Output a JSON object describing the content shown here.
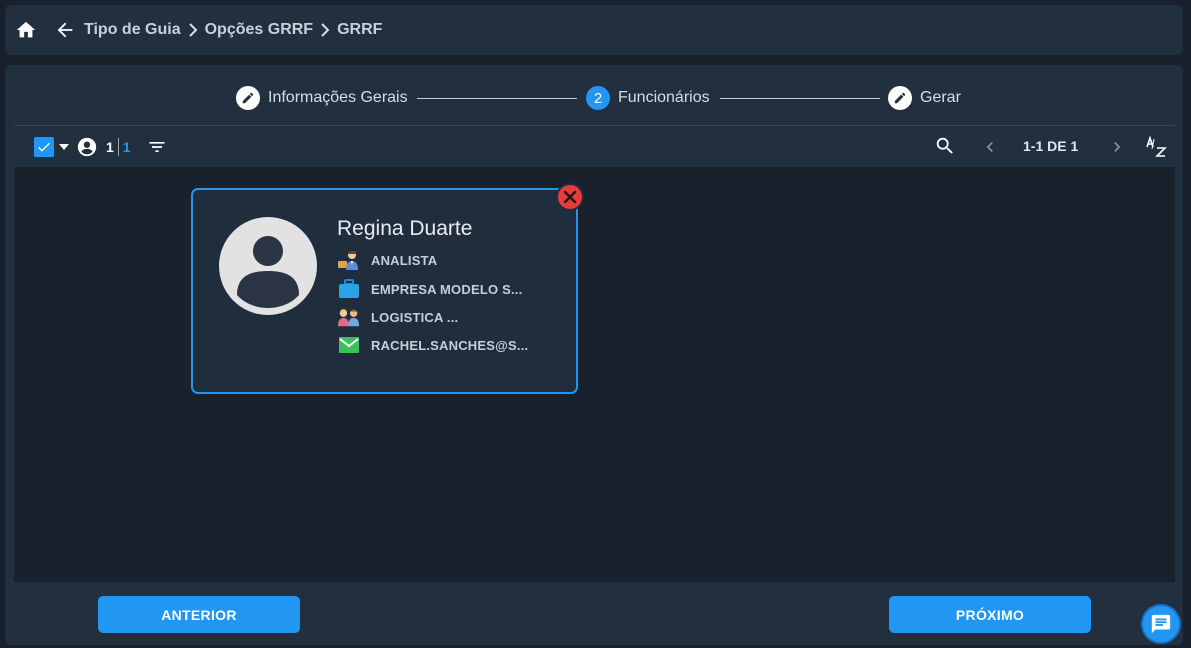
{
  "breadcrumb": {
    "items": [
      "Tipo de Guia",
      "Opções GRRF",
      "GRRF"
    ]
  },
  "stepper": {
    "steps": [
      {
        "label": "Informações Gerais",
        "icon": "pencil-icon"
      },
      {
        "label": "Funcionários",
        "number": "2"
      },
      {
        "label": "Gerar",
        "icon": "pencil-icon"
      }
    ]
  },
  "toolbar": {
    "selected_count": "1",
    "total_count": "1",
    "pagination": "1-1 DE 1"
  },
  "employee_card": {
    "name": "Regina Duarte",
    "role": "ANALISTA",
    "company": "EMPRESA MODELO S...",
    "department": "LOGISTICA ...",
    "email": "RACHEL.SANCHES@S..."
  },
  "footer": {
    "prev_label": "ANTERIOR",
    "next_label": "PRÓXIMO"
  },
  "colors": {
    "accent": "#2196f3",
    "danger": "#ea3b3b",
    "panel": "#222f3f",
    "background": "#18202b"
  }
}
